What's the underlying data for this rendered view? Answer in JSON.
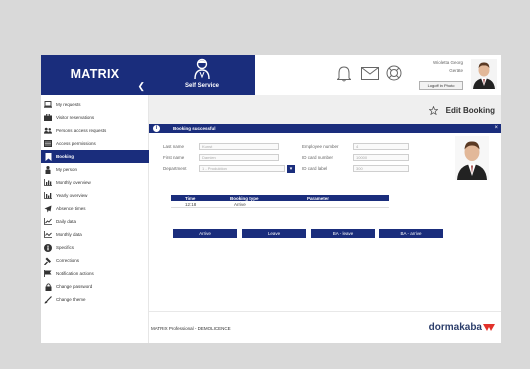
{
  "brand": {
    "name": "MATRIX",
    "collapse_icon": "chevron-left-icon"
  },
  "header": {
    "self_service_label": "Self Service",
    "icons": [
      "bell-icon",
      "envelope-icon",
      "lifebuoy-icon"
    ],
    "user_name": "Wioletta Georg",
    "user_role": "Geräte",
    "logout_label": "Logoff in Photo"
  },
  "sidebar": {
    "items": [
      {
        "label": "My requests",
        "icon": "laptop-icon"
      },
      {
        "label": "Visitor reservations",
        "icon": "briefcase-icon"
      },
      {
        "label": "Persons access requests",
        "icon": "users-icon"
      },
      {
        "label": "Access permissions",
        "icon": "list-icon"
      },
      {
        "label": "Booking",
        "icon": "bookmark-icon",
        "active": true
      },
      {
        "label": "My person",
        "icon": "person-icon"
      },
      {
        "label": "Monthly overview",
        "icon": "bar-chart-icon"
      },
      {
        "label": "Yearly overview",
        "icon": "bar-chart-icon"
      },
      {
        "label": "Absence times",
        "icon": "plane-icon"
      },
      {
        "label": "Daily data",
        "icon": "line-chart-icon"
      },
      {
        "label": "Monthly data",
        "icon": "line-chart-icon"
      },
      {
        "label": "Specifics",
        "icon": "info-icon"
      },
      {
        "label": "Corrections",
        "icon": "gavel-icon"
      },
      {
        "label": "Notification actions",
        "icon": "flag-icon"
      },
      {
        "label": "Change password",
        "icon": "lock-icon"
      },
      {
        "label": "Change theme",
        "icon": "brush-icon"
      }
    ]
  },
  "main": {
    "page_title": "Edit Booking",
    "alert": {
      "text": "Booking successful",
      "close": "×"
    },
    "form": {
      "last_name_label": "Last name",
      "last_name_value": "Kunst",
      "first_name_label": "First name",
      "first_name_value": "Damien",
      "department_label": "Department",
      "department_value": "1 - Produktion",
      "employee_number_label": "Employee number",
      "employee_number_value": "4",
      "id_card_number_label": "ID card number",
      "id_card_number_value": "10000",
      "id_card_label_label": "ID card label",
      "id_card_label_value": "300"
    },
    "table": {
      "headers": [
        "Time",
        "Booking type",
        "Parameter"
      ],
      "rows": [
        [
          "12:18",
          "Arrive",
          ""
        ]
      ]
    },
    "actions": [
      "Arrive",
      "Leave",
      "BA - leave",
      "BA - arrive"
    ]
  },
  "footer": {
    "text": "MATRIX Professional - DEMOLICENCE",
    "logo_text": "dormakaba"
  },
  "colors": {
    "primary": "#1a2d7c",
    "logo_accent": "#e2312a"
  }
}
